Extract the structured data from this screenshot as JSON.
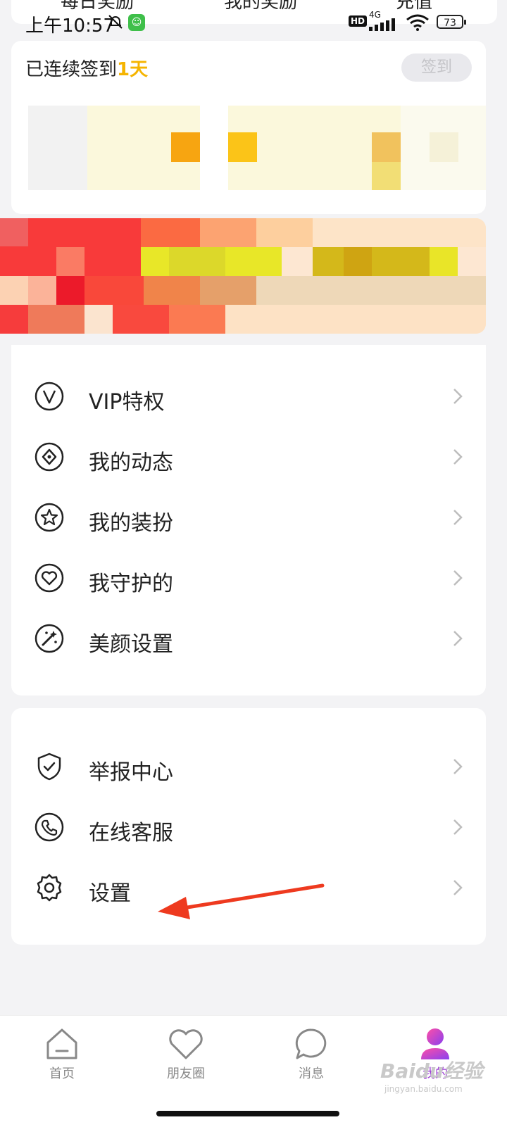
{
  "top_tabs": [
    "每日奖励",
    "我的奖励",
    "充值"
  ],
  "status_bar": {
    "time": "上午10:57",
    "network": "4G",
    "hd": "HD",
    "battery": "73"
  },
  "checkin": {
    "prefix": "已连续签到",
    "days": "1天",
    "button": "签到"
  },
  "menu_group1": [
    {
      "label": "VIP特权",
      "icon": "vip-icon"
    },
    {
      "label": "我的动态",
      "icon": "diamond-icon"
    },
    {
      "label": "我的装扮",
      "icon": "star-icon"
    },
    {
      "label": "我守护的",
      "icon": "heart-icon"
    },
    {
      "label": "美颜设置",
      "icon": "beauty-icon"
    }
  ],
  "menu_group2": [
    {
      "label": "举报中心",
      "icon": "shield-icon"
    },
    {
      "label": "在线客服",
      "icon": "phone-icon"
    },
    {
      "label": "设置",
      "icon": "gear-icon"
    }
  ],
  "bottom_nav": [
    {
      "label": "首页",
      "icon": "home-icon"
    },
    {
      "label": "朋友圈",
      "icon": "heart-icon"
    },
    {
      "label": "消息",
      "icon": "chat-icon"
    },
    {
      "label": "我的",
      "icon": "profile-icon",
      "active": true
    }
  ],
  "watermark": {
    "brand": "Baidu经验",
    "url": "jingyan.baidu.com"
  },
  "colors": {
    "accent": "#f5b400",
    "active_tab": "#9d3bd6",
    "annotation_arrow": "#ee3a1f"
  }
}
